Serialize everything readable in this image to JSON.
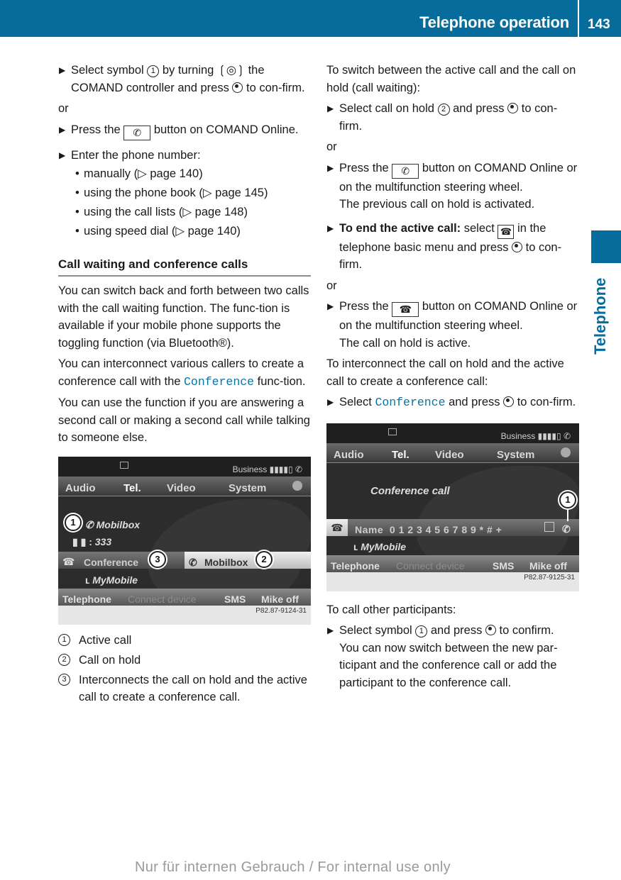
{
  "header": {
    "title": "Telephone operation",
    "page_number": "143",
    "side_tab": "Telephone",
    "color": "#056c9c"
  },
  "left": {
    "steps_top": [
      {
        "parts": [
          "Select symbol ",
          "1",
          " by turning ",
          " the COMAND controller and press ",
          " to con-firm."
        ]
      }
    ],
    "or1": "or",
    "press_step": [
      "Press the ",
      " button on COMAND Online."
    ],
    "enter_step": "Enter the phone number:",
    "enter_options": [
      "manually (▷ page 140)",
      "using the phone book (▷ page 145)",
      "using the call lists (▷ page 148)",
      "using speed dial (▷ page 140)"
    ],
    "section_title": "Call waiting and conference calls",
    "para1": "You can switch back and forth between two calls with the call waiting function. The func-tion is available if your mobile phone supports the toggling function (via Bluetooth®).",
    "para2_before": "You can interconnect various callers to create a conference call with the ",
    "para2_term": "Conference",
    "para2_after": " func-tion.",
    "para3": "You can use the function if you are answering a second call or making a second call while talking to someone else.",
    "legend": [
      {
        "num": "1",
        "text": "Active call"
      },
      {
        "num": "2",
        "text": "Call on hold"
      },
      {
        "num": "3",
        "text": "Interconnects the call on hold and the active call to create a conference call."
      }
    ]
  },
  "screen1": {
    "status": "Business ▮▮▮▮▯ ✆",
    "menu": [
      "Audio",
      "Tel.",
      "Video",
      "System"
    ],
    "active_caller": "Mobilbox",
    "active_number": "333",
    "conference_label": "Conference",
    "held_caller": "Mobilbox",
    "my_phone": "MyMobile",
    "bottom": [
      "Telephone",
      "Connect device",
      "SMS",
      "Mike off"
    ],
    "callouts": [
      "1",
      "2",
      "3"
    ],
    "code": "P82.87-9124-31"
  },
  "right": {
    "intro1": "To switch between the active call and the call on hold (call waiting):",
    "step1": [
      "Select call on hold ",
      "2",
      " and press ",
      " to con-firm."
    ],
    "or1": "or",
    "step2": [
      "Press the ",
      " button on COMAND Online or on the multifunction steering wheel."
    ],
    "step2_result": "The previous call on hold is activated.",
    "step3_bold": "To end the active call:",
    "step3": [
      " select ",
      " in the telephone basic menu and press ",
      " to con-firm."
    ],
    "or2": "or",
    "step4": [
      "Press the ",
      " button on COMAND Online or on the multifunction steering wheel."
    ],
    "step4_result": "The call on hold is active.",
    "intro2": "To interconnect the call on hold and the active call to create a conference call:",
    "step5": [
      "Select ",
      "Conference",
      " and press ",
      " to con-firm."
    ],
    "intro3": "To call other participants:",
    "step6": [
      "Select symbol ",
      "1",
      " and press ",
      " to confirm."
    ],
    "step6_result": "You can now switch between the new par-ticipant and the conference call or add the participant to the conference call."
  },
  "screen2": {
    "status": "Business ▮▮▮▮▯ ✆",
    "menu": [
      "Audio",
      "Tel.",
      "Video",
      "System"
    ],
    "title": "Conference call",
    "dial_row": "Name  0 1 2 3 4 5 6 7 8 9 * # +",
    "my_phone": "MyMobile",
    "bottom": [
      "Telephone",
      "Connect device",
      "SMS",
      "Mike off"
    ],
    "callouts": [
      "1"
    ],
    "code": "P82.87-9125-31"
  },
  "watermark": "Nur für internen Gebrauch / For internal use only",
  "icons": {
    "step_marker": "▶",
    "bullet": "•",
    "turn": "❲◎❳",
    "phone_handset": "✆",
    "hangup": "☎"
  }
}
